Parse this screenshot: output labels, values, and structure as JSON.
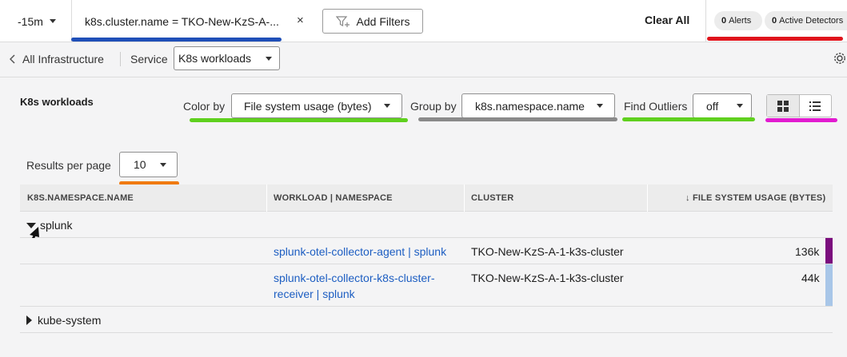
{
  "topbar": {
    "time_range": "-15m",
    "filter_text": "k8s.cluster.name = TKO-New-KzS-A-...",
    "close_glyph": "×",
    "add_filters_label": "Add Filters",
    "clear_all_label": "Clear All",
    "alerts_count": "0",
    "alerts_label": "Alerts",
    "detectors_count": "0",
    "detectors_label": "Active Detectors"
  },
  "breadcrumb": {
    "back_label": "All Infrastructure",
    "service_label": "Service",
    "service_value": "K8s workloads"
  },
  "panel": {
    "title": "K8s workloads",
    "color_by_label": "Color by",
    "color_by_value": "File system usage (bytes)",
    "group_by_label": "Group by",
    "group_by_value": "k8s.namespace.name",
    "outliers_label": "Find Outliers",
    "outliers_value": "off",
    "results_label": "Results per page",
    "results_value": "10"
  },
  "table": {
    "headers": [
      "K8S.NAMESPACE.NAME",
      "WORKLOAD | NAMESPACE",
      "CLUSTER",
      "↓ FILE SYSTEM USAGE (BYTES)"
    ],
    "groups": [
      {
        "name": "splunk",
        "rows": [
          {
            "workload_line1": "splunk-otel-collector-agent | splunk",
            "workload_line2": "",
            "cluster": "TKO-New-KzS-A-1-k3s-cluster",
            "usage": "136k",
            "color": "#7b0d7e"
          },
          {
            "workload_line1": "splunk-otel-collector-k8s-cluster-",
            "workload_line2": "receiver | splunk",
            "cluster": "TKO-New-KzS-A-1-k3s-cluster",
            "usage": "44k",
            "color": "#a8c6e8"
          }
        ]
      },
      {
        "name": "kube-system",
        "rows": []
      }
    ]
  },
  "annotation_colors": {
    "blue": "#1f4fb8",
    "red": "#e0141c",
    "green": "#5fd01e",
    "gray": "#8a8a8a",
    "magenta": "#e21bd0",
    "orange": "#f07a10"
  }
}
